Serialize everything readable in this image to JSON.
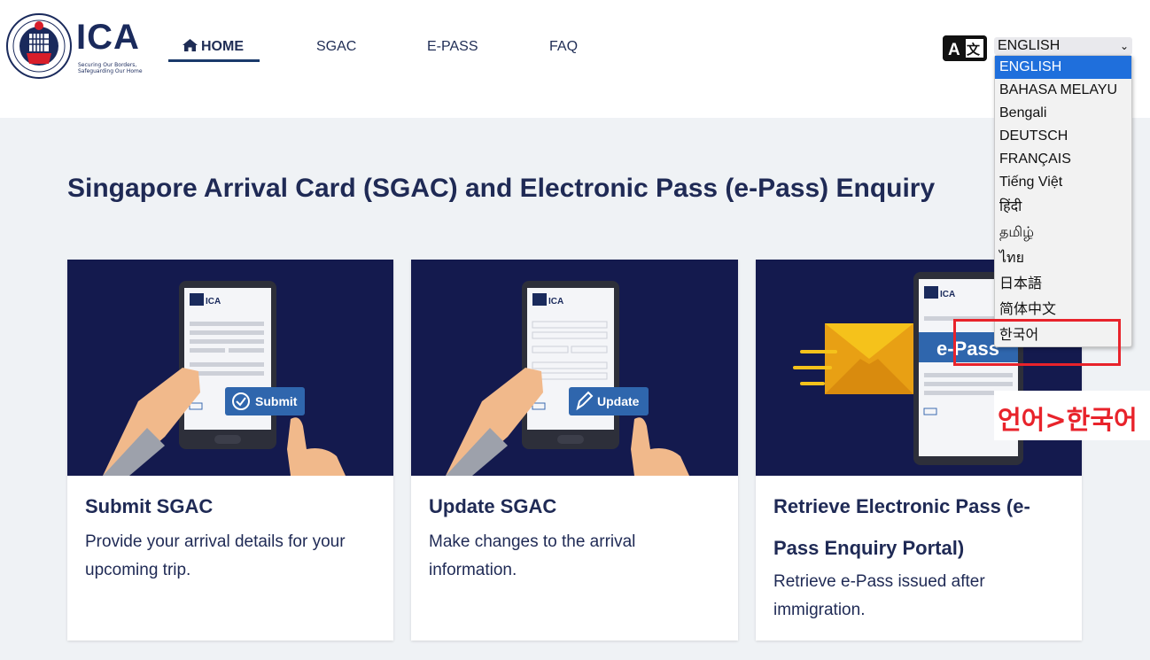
{
  "header": {
    "logo_text": "ICA",
    "logo_tagline": "Securing Our Borders, Safeguarding Our Home",
    "nav": [
      {
        "label": "HOME",
        "icon": "home-icon"
      },
      {
        "label": "SGAC"
      },
      {
        "label": "E-PASS"
      },
      {
        "label": "FAQ"
      }
    ],
    "language_icon": "translate-icon",
    "language_select_value": "ENGLISH",
    "language_options": [
      "ENGLISH",
      "BAHASA MELAYU",
      "Bengali",
      "DEUTSCH",
      "FRANÇAIS",
      "Tiếng Việt",
      "हिंदी",
      "தமிழ்",
      "ไทย",
      "日本語",
      "简体中文",
      "한국어"
    ]
  },
  "annotation": {
    "text": "언어>한국어",
    "color": "#e8232b"
  },
  "main": {
    "title": "Singapore Arrival Card (SGAC) and Electronic Pass (e-Pass) Enquiry",
    "cards": [
      {
        "title": "Submit SGAC",
        "description": "Provide your arrival details for your upcoming trip.",
        "image_button": "Submit"
      },
      {
        "title": "Update SGAC",
        "description": "Make changes to the arrival information.",
        "image_button": "Update"
      },
      {
        "title": "Retrieve Electronic Pass (e-Pass Enquiry Portal)",
        "description": "Retrieve e-Pass issued after immigration.",
        "image_banner": "e-Pass"
      }
    ]
  },
  "colors": {
    "navy": "#1f2a55",
    "card_image_bg": "#141a4e",
    "selected_option": "#1f6fdc",
    "page_bg": "#eff2f5"
  }
}
